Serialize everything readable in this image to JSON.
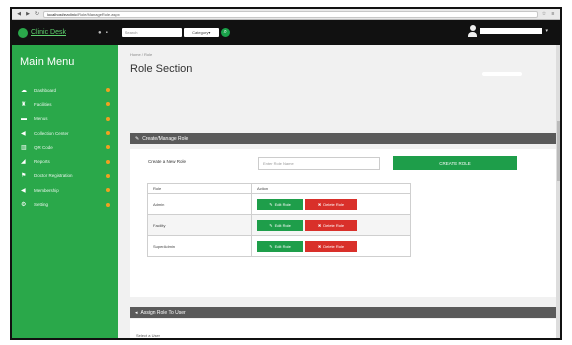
{
  "browser": {
    "url_domain": "localhost/ezclinic",
    "url_path": "/Role/ManageRole.aspx"
  },
  "topnav": {
    "brand": "Clinic Desk",
    "search_placeholder": "Search",
    "category_label": "Category",
    "category_caret": "▾",
    "go_icon": "search-icon"
  },
  "sidebar": {
    "title": "Main Menu",
    "items": [
      {
        "label": "Dashboard",
        "icon": "cloud-icon"
      },
      {
        "label": "Facilities",
        "icon": "trophy-icon"
      },
      {
        "label": "Menus",
        "icon": "monitor-icon"
      },
      {
        "label": "Collection Center",
        "icon": "megaphone-icon"
      },
      {
        "label": "QR Code",
        "icon": "barcode-icon"
      },
      {
        "label": "Reports",
        "icon": "chart-icon"
      },
      {
        "label": "Doctor Registration",
        "icon": "tag-icon"
      },
      {
        "label": "Membership",
        "icon": "megaphone-icon"
      },
      {
        "label": "Setting",
        "icon": "gear-icon"
      }
    ]
  },
  "main": {
    "breadcrumb": "Home / Role",
    "title": "Role Section",
    "create_panel": {
      "header": "Create/Manage Role",
      "new_role_label": "Create a New Role",
      "input_placeholder": "Enter Role Name",
      "create_button": "CREATE ROLE",
      "columns": [
        "Role",
        "Action"
      ],
      "rows": [
        {
          "role": "Admin"
        },
        {
          "role": "Facility"
        },
        {
          "role": "SuperAdmin"
        }
      ],
      "edit_label": "Edit Role",
      "delete_label": "Delete Role"
    },
    "assign_panel": {
      "header": "Assign Role To User",
      "select_user_label": "Select a User"
    }
  },
  "colors": {
    "sidebar": "#2aa84a",
    "topnav": "#111111",
    "edit_button": "#1e9e4a",
    "delete_button": "#d9302a",
    "panel_header": "#5a5a5a"
  }
}
